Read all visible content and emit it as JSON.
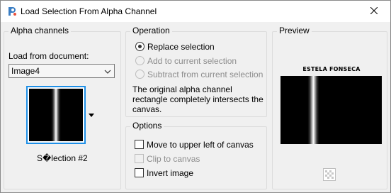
{
  "window": {
    "title": "Load Selection From Alpha Channel"
  },
  "alpha_channels": {
    "title": "Alpha channels",
    "load_from_label": "Load from document:",
    "document_value": "Image4",
    "selection_name": "S�lection #2"
  },
  "operation": {
    "title": "Operation",
    "options": [
      {
        "label": "Replace selection",
        "selected": true,
        "enabled": true
      },
      {
        "label": "Add to current selection",
        "selected": false,
        "enabled": false
      },
      {
        "label": "Subtract from current selection",
        "selected": false,
        "enabled": false
      }
    ],
    "description": "The original alpha channel rectangle completely intersects the canvas."
  },
  "options": {
    "title": "Options",
    "items": [
      {
        "label": "Move to upper left of canvas",
        "checked": false,
        "enabled": true
      },
      {
        "label": "Clip to canvas",
        "checked": false,
        "enabled": false
      },
      {
        "label": "Invert image",
        "checked": false,
        "enabled": true
      }
    ]
  },
  "preview": {
    "title": "Preview",
    "watermark": "ESTELA FONSECA"
  },
  "colors": {
    "accent": "#1e8fe6",
    "window_bg": "#f0f0f0",
    "disabled_text": "#8d8d8d"
  }
}
